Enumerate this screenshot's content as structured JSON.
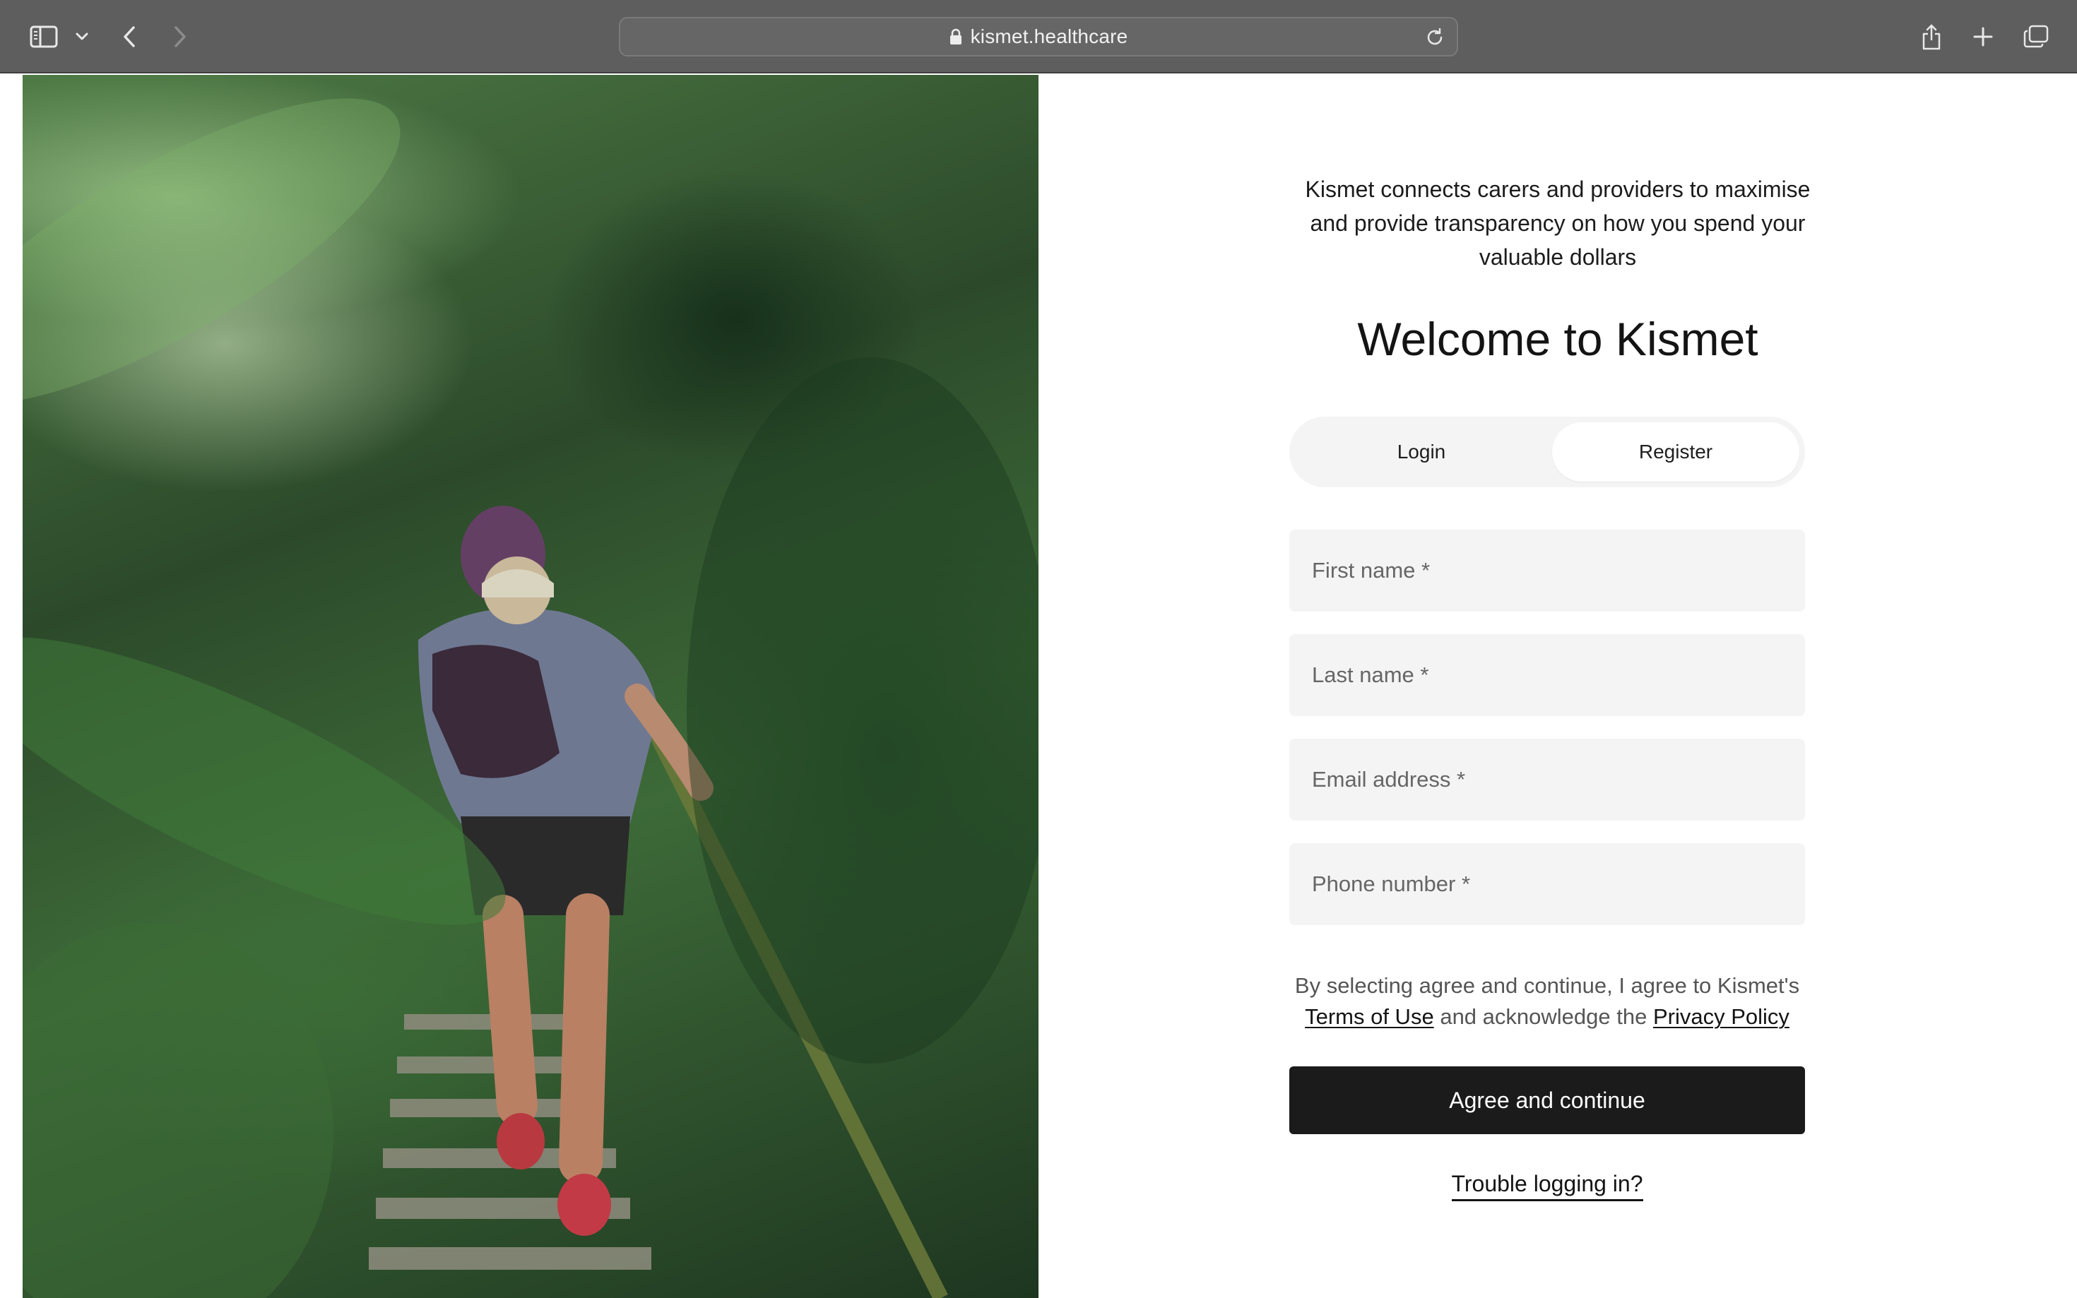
{
  "browser": {
    "url": "kismet.healthcare",
    "icons": {
      "sidebar": "sidebar-icon",
      "tabs_menu": "chevron-down-icon",
      "back": "chevron-left-icon",
      "forward": "chevron-right-icon",
      "lock": "lock-icon",
      "reload": "reload-icon",
      "share": "share-icon",
      "new_tab": "plus-icon",
      "tab_overview": "tab-overview-icon"
    }
  },
  "hero": {
    "tagline": "Kismet connects carers and providers to maximise and provide transparency on how you spend your valuable dollars",
    "title": "Welcome to Kismet"
  },
  "auth_tabs": {
    "login": "Login",
    "register": "Register",
    "active": "register"
  },
  "form": {
    "first_name": {
      "value": "",
      "placeholder": "First name *"
    },
    "last_name": {
      "value": "",
      "placeholder": "Last name *"
    },
    "email": {
      "value": "",
      "placeholder": "Email address *"
    },
    "phone": {
      "value": "",
      "placeholder": "Phone number *"
    }
  },
  "legal": {
    "prefix": "By selecting agree and continue, I agree to Kismet's",
    "terms_link": "Terms of Use",
    "middle": "and acknowledge the",
    "privacy_link": "Privacy Policy"
  },
  "actions": {
    "agree_button": "Agree and continue",
    "trouble_link": "Trouble logging in?"
  },
  "colors": {
    "toolbar_bg": "#5e5e5e",
    "field_bg": "#f4f4f4",
    "primary_button": "#1b1b1b",
    "text": "#141414"
  }
}
